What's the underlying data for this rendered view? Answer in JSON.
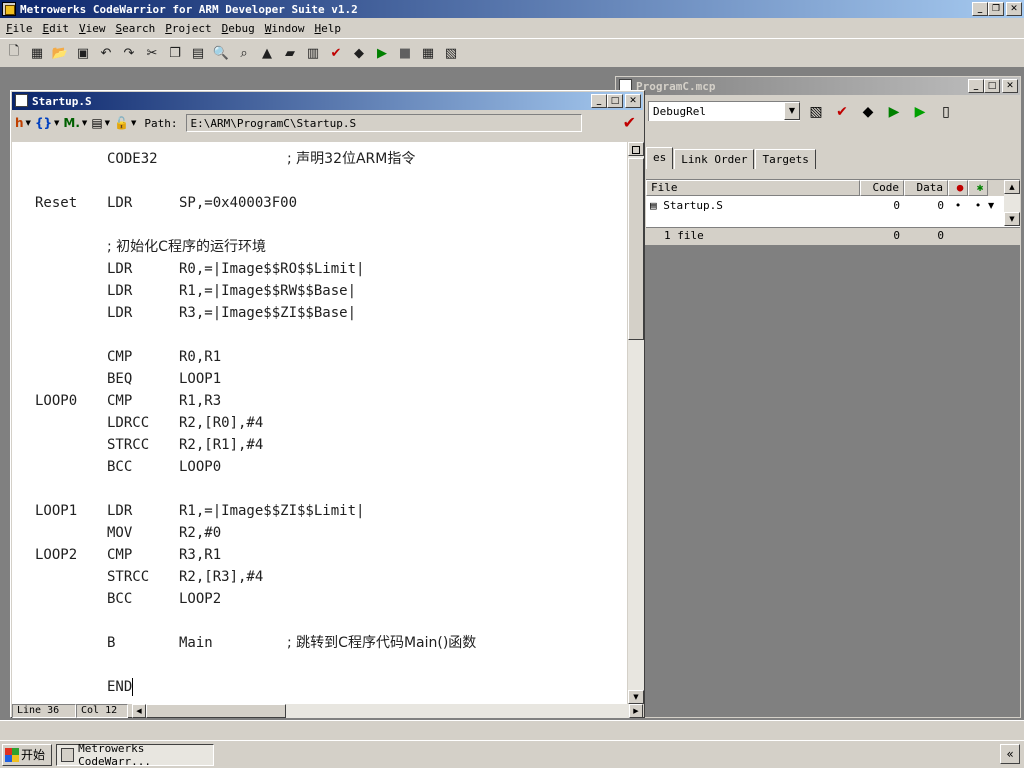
{
  "app": {
    "title": "Metrowerks CodeWarrior for ARM Developer Suite v1.2",
    "caption_buttons": {
      "minimize": "_",
      "restore": "❐",
      "close": "✕"
    }
  },
  "menu": [
    {
      "hot": "F",
      "rest": "ile"
    },
    {
      "hot": "E",
      "rest": "dit"
    },
    {
      "hot": "V",
      "rest": "iew"
    },
    {
      "hot": "S",
      "rest": "earch"
    },
    {
      "hot": "P",
      "rest": "roject"
    },
    {
      "hot": "D",
      "rest": "ebug"
    },
    {
      "hot": "W",
      "rest": "indow"
    },
    {
      "hot": "H",
      "rest": "elp"
    }
  ],
  "toolbar_icons": [
    "new-file-icon",
    "new-project-icon",
    "open-icon",
    "save-icon",
    "undo-icon",
    "redo-icon",
    "cut-icon",
    "copy-icon",
    "paste-icon",
    "find-icon",
    "find-in-files-icon",
    "compile-icon",
    "make-icon",
    "disassemble-icon",
    "check-syntax-icon",
    "preprocess-icon",
    "debug-icon",
    "stop-icon",
    "settings-icon",
    "target-settings-icon"
  ],
  "editor": {
    "title": "Startup.S",
    "path_label": "Path:",
    "path_value": "E:\\ARM\\ProgramC\\Startup.S",
    "status_line": "Line 36",
    "status_col": "Col 12",
    "code": [
      {
        "label": "",
        "op": "CODE32",
        "arg": "",
        "comment": "; 声明32位ARM指令"
      },
      {
        "label": "",
        "op": "",
        "arg": "",
        "comment": ""
      },
      {
        "label": "Reset",
        "op": "LDR",
        "arg": "SP,=0x40003F00",
        "comment": ""
      },
      {
        "label": "",
        "op": "",
        "arg": "",
        "comment": ""
      },
      {
        "label": "",
        "op": "; 初始化C程序的运行环境",
        "arg": "",
        "comment": ""
      },
      {
        "label": "",
        "op": "LDR",
        "arg": "R0,=|Image$$RO$$Limit|",
        "comment": ""
      },
      {
        "label": "",
        "op": "LDR",
        "arg": "R1,=|Image$$RW$$Base|",
        "comment": ""
      },
      {
        "label": "",
        "op": "LDR",
        "arg": "R3,=|Image$$ZI$$Base|",
        "comment": ""
      },
      {
        "label": "",
        "op": "",
        "arg": "",
        "comment": ""
      },
      {
        "label": "",
        "op": "CMP",
        "arg": "R0,R1",
        "comment": ""
      },
      {
        "label": "",
        "op": "BEQ",
        "arg": "LOOP1",
        "comment": ""
      },
      {
        "label": "LOOP0",
        "op": "CMP",
        "arg": "R1,R3",
        "comment": ""
      },
      {
        "label": "",
        "op": "LDRCC",
        "arg": "R2,[R0],#4",
        "comment": ""
      },
      {
        "label": "",
        "op": "STRCC",
        "arg": "R2,[R1],#4",
        "comment": ""
      },
      {
        "label": "",
        "op": "BCC",
        "arg": "LOOP0",
        "comment": ""
      },
      {
        "label": "",
        "op": "",
        "arg": "",
        "comment": ""
      },
      {
        "label": "LOOP1",
        "op": "LDR",
        "arg": "R1,=|Image$$ZI$$Limit|",
        "comment": ""
      },
      {
        "label": "",
        "op": "MOV",
        "arg": "R2,#0",
        "comment": ""
      },
      {
        "label": "LOOP2",
        "op": "CMP",
        "arg": "R3,R1",
        "comment": ""
      },
      {
        "label": "",
        "op": "STRCC",
        "arg": "R2,[R3],#4",
        "comment": ""
      },
      {
        "label": "",
        "op": "BCC",
        "arg": "LOOP2",
        "comment": ""
      },
      {
        "label": "",
        "op": "",
        "arg": "",
        "comment": ""
      },
      {
        "label": "",
        "op": "B",
        "arg": "Main",
        "comment": "; 跳转到C程序代码Main()函数"
      },
      {
        "label": "",
        "op": "",
        "arg": "",
        "comment": ""
      },
      {
        "label": "",
        "op": "END",
        "arg": "",
        "comment": ""
      }
    ]
  },
  "project": {
    "title": "ProgramC.mcp",
    "target": "DebugRel",
    "tabs": [
      "es",
      "Link Order",
      "Targets"
    ],
    "columns": {
      "file": "File",
      "code": "Code",
      "data": "Data"
    },
    "files": [
      {
        "name": "Startup.S",
        "code": "0",
        "data": "0",
        "dbg": "•",
        "bug": "•"
      }
    ],
    "footer": {
      "count": "1 file",
      "code": "0",
      "data": "0"
    }
  },
  "taskbar": {
    "start_label": "开始",
    "task_label": "Metrowerks CodeWarr...",
    "tray_chevron": "«"
  }
}
